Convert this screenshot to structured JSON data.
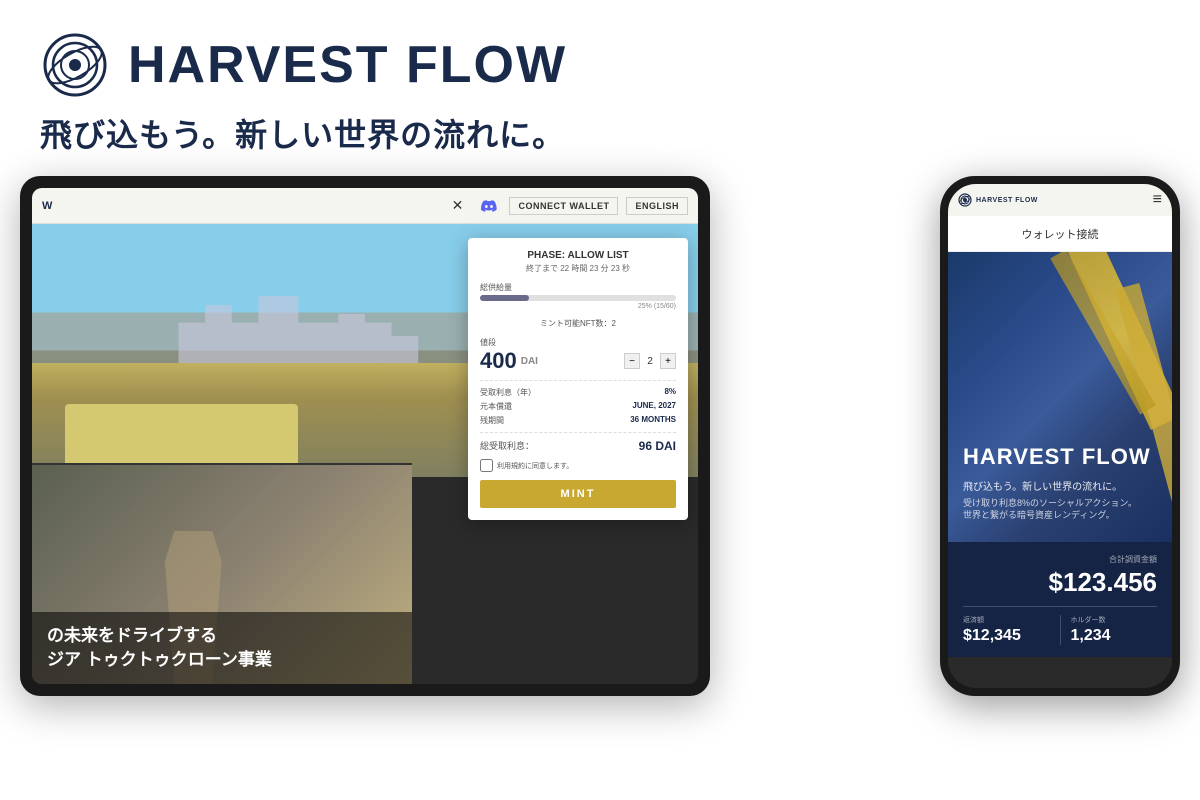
{
  "brand": {
    "name": "HARVEST FLOW",
    "tagline": "飛び込もう。新しい世界の流れに。"
  },
  "tablet": {
    "nav": {
      "brand": "W",
      "connect_btn": "CONNECT WALLET",
      "english_btn": "ENGLISH"
    },
    "overlay_text": "の未来をドライブする\nジア トゥクトゥクローン事業",
    "mint_card": {
      "phase": "PHASE: ALLOW LIST",
      "countdown": "終了まで 22 時間 23 分 23 秒",
      "supply_label": "総供給量",
      "supply_percent": "25% (15/60)",
      "nft_count_label": "ミント可能NFT数：2",
      "price_label": "値段",
      "price_value": "400",
      "price_unit": "DAI",
      "quantity": "2",
      "interest_label": "受取利息（年）",
      "interest_value": "8%",
      "maturity_label": "元本償還",
      "maturity_value": "JUNE, 2027",
      "duration_label": "残期間",
      "duration_value": "36 MONTHS",
      "total_label": "総受取利息：",
      "total_value": "96 DAI",
      "agree_label": "利用規約に同意します。",
      "mint_btn": "MINT"
    }
  },
  "phone": {
    "nav": {
      "brand": "HARVEST FLOW",
      "menu_icon": "≡"
    },
    "wallet_bar": "ウォレット接続",
    "hero": {
      "title": "HARVEST FLOW",
      "tagline": "飛び込もう。新しい世界の流れに。",
      "desc": "受け取り利息8%のソーシャルアクション。\n世界と繋がる暗号資産レンディング。"
    },
    "stats": {
      "total_label": "合計調資金額",
      "total_value": "$123.456",
      "repay_label": "返済額",
      "repay_value": "$12,345",
      "holders_label": "ホルダー数",
      "holders_value": "1,234"
    }
  },
  "colors": {
    "primary": "#1a2a4a",
    "gold": "#c8a830",
    "white": "#ffffff"
  }
}
